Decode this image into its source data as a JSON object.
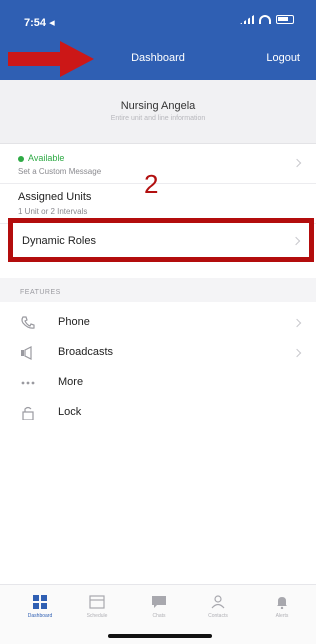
{
  "status_bar": {
    "time": "7:54 ◂"
  },
  "header": {
    "title": "Dashboard",
    "logout_label": "Logout"
  },
  "profile": {
    "name": "Nursing Angela",
    "subtitle": "Entire unit and line information"
  },
  "status": {
    "presence": "Available",
    "custom_message": "Set a Custom Message"
  },
  "annotation": {
    "number": "2"
  },
  "assigned_units": {
    "title": "Assigned Units",
    "subtitle": "1 Unit or 2 Intervals"
  },
  "dynamic_roles": {
    "title": "Dynamic Roles"
  },
  "features": {
    "section_label": "FEATURES",
    "items": [
      {
        "label": "Phone",
        "icon": "phone-icon"
      },
      {
        "label": "Broadcasts",
        "icon": "broadcast-icon"
      },
      {
        "label": "More",
        "icon": "more-icon"
      },
      {
        "label": "Lock",
        "icon": "lock-icon"
      }
    ]
  },
  "tabbar": {
    "tabs": [
      {
        "label": "Dashboard",
        "icon": "grid-icon",
        "active": true
      },
      {
        "label": "Schedule",
        "icon": "schedule-icon"
      },
      {
        "label": "Chats",
        "icon": "chat-icon"
      },
      {
        "label": "Contacts",
        "icon": "contacts-icon"
      },
      {
        "label": "Alerts",
        "icon": "bell-icon"
      }
    ]
  },
  "colors": {
    "header_blue": "#2f5fb3",
    "available_green": "#2eaa45",
    "annotation_red": "#b30d0d"
  }
}
